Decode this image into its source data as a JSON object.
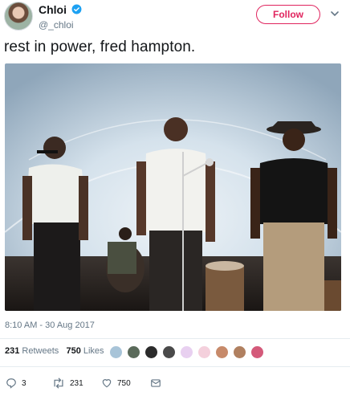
{
  "author": {
    "name": "Chloi",
    "handle": "@_chloi"
  },
  "follow_label": "Follow",
  "tweet": {
    "text": "rest in power, fred hampton."
  },
  "timestamp": "8:10 AM - 30 Aug 2017",
  "stats": {
    "retweets": "231",
    "retweets_label": "Retweets",
    "likes": "750",
    "likes_label": "Likes"
  },
  "actions": {
    "replies": "3",
    "retweets": "231",
    "likes": "750"
  },
  "colors": {
    "accent": "#e0245e",
    "verified": "#1da1f2",
    "muted": "#657786"
  },
  "icons": [
    "avatar",
    "verified-badge-icon",
    "chevron-down-icon",
    "reply-icon",
    "retweet-icon",
    "heart-icon",
    "message-icon"
  ]
}
